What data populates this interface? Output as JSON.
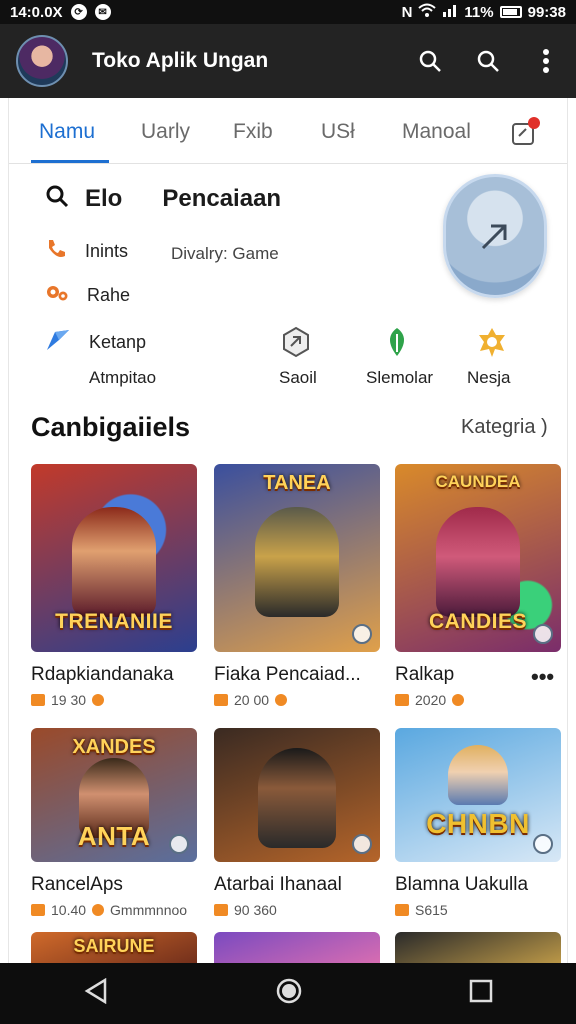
{
  "status_bar": {
    "time": "14:0.0X",
    "battery": "11%",
    "clock": "99:38"
  },
  "app_bar": {
    "title": "Toko Aplik Ungan"
  },
  "tabs": [
    {
      "label": "Namu",
      "active": true
    },
    {
      "label": "Uarly"
    },
    {
      "label": "Fxib"
    },
    {
      "label": "USł"
    },
    {
      "label": "Manoal"
    }
  ],
  "search": {
    "label": "Elo",
    "title": "Pencaiaan"
  },
  "options": [
    {
      "label": "Inints",
      "icon": "phone-icon"
    },
    {
      "label": "Rahe",
      "icon": "gears-icon"
    },
    {
      "label": "Ketanp",
      "icon": "arrow-icon"
    }
  ],
  "option_subtitle": "Divalry: Game",
  "option_caption": "Atmpitao",
  "mini_categories": [
    {
      "label": "Saoil",
      "icon": "hex-icon"
    },
    {
      "label": "Slemolar",
      "icon": "leaf-icon"
    },
    {
      "label": "Nesja",
      "icon": "badge-icon"
    }
  ],
  "section": {
    "title": "Canbigaiiels",
    "link": "Kategria )"
  },
  "games": [
    {
      "title": "Rdapkiandanaka",
      "meta": "19 30",
      "banner": "TRENANIIE",
      "top_banner": "",
      "colors": [
        "#c23a2a",
        "#2b3f8f"
      ]
    },
    {
      "title": "Fiaka Pencaiad...",
      "meta": "20 00",
      "banner": "",
      "top_banner": "TANEA",
      "colors": [
        "#3a4f9e",
        "#e0a04a"
      ]
    },
    {
      "title": "Ralkap",
      "meta": "2020",
      "banner": "CANDIES",
      "top_banner": "CAUNDEA",
      "colors": [
        "#d98a2a",
        "#7a2d6b"
      ]
    },
    {
      "title": "RancelAps",
      "meta": "10.40",
      "meta_extra": "Gmmmnnoo",
      "banner": "ANTA",
      "top_banner": "XANDES",
      "colors": [
        "#9a4a2a",
        "#5a6f9e"
      ]
    },
    {
      "title": "Atarbai Ihanaal",
      "meta": "90 360",
      "banner": "",
      "top_banner": "",
      "colors": [
        "#3a2a22",
        "#b5652a"
      ]
    },
    {
      "title": "Blamna Uakulla",
      "meta": "S615",
      "banner": "CHNBN",
      "top_banner": "",
      "colors": [
        "#5aa8e0",
        "#d8e8f6"
      ]
    }
  ],
  "more_icon": "more-horizontal-icon",
  "partial_row": [
    {
      "top_banner": "SAIRUNE",
      "colors": [
        "#d06a2a",
        "#6a2a1a"
      ]
    },
    {
      "top_banner": "",
      "colors": [
        "#7a4ac0",
        "#e070b0"
      ]
    },
    {
      "top_banner": "",
      "colors": [
        "#2a2a2a",
        "#c9a24a"
      ]
    }
  ]
}
